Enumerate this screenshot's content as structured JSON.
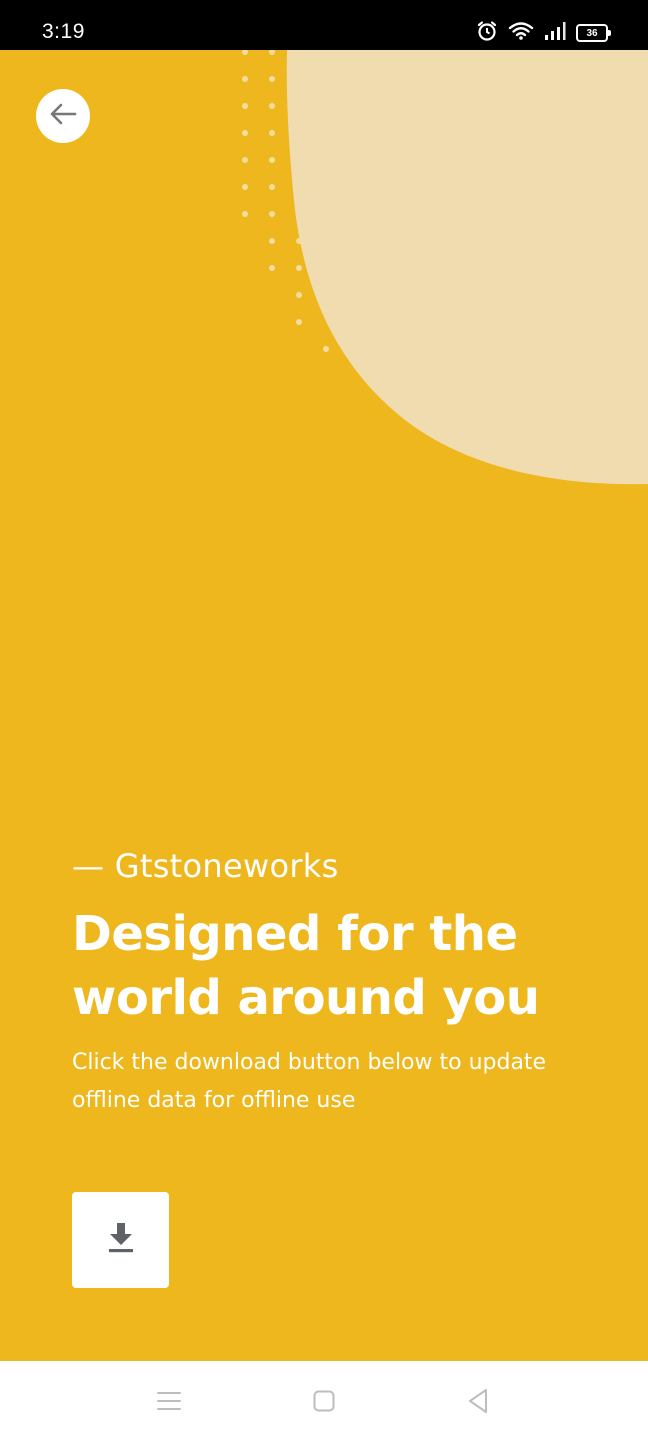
{
  "status_bar": {
    "time": "3:19",
    "battery_level": "36",
    "icons": [
      "alarm-icon",
      "wifi-icon",
      "signal-icon",
      "battery-icon"
    ]
  },
  "colors": {
    "background": "#EEB71D",
    "blob": "#F0DCAE",
    "text": "#FFFFFF",
    "icon_gray": "#5F6368"
  },
  "header": {
    "back_icon": "arrow-left-icon"
  },
  "content": {
    "brand": "— Gtstoneworks",
    "headline": "Designed for the world around you",
    "description": "Click the download button below to update offline data for offline use"
  },
  "actions": {
    "download_icon": "download-icon"
  },
  "nav_bar": {
    "items": [
      "menu-icon",
      "home-icon",
      "back-icon"
    ]
  }
}
